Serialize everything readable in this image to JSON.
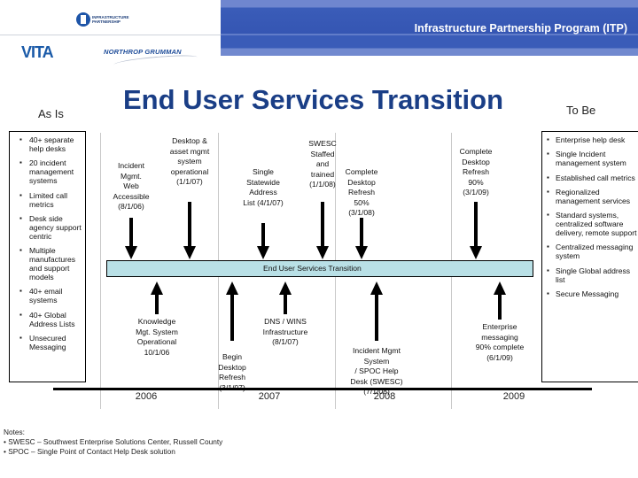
{
  "header": {
    "banner_title": "Infrastructure Partnership Program (ITP)",
    "logos": {
      "itp": "INFRASTRUCTURE PARTNERSHIP",
      "vita": "VITA",
      "northrop": "NORTHROP GRUMMAN"
    }
  },
  "title": "End User Services Transition",
  "as_is": {
    "label": "As Is",
    "items": [
      "40+ separate help desks",
      "20 incident management systems",
      "Limited call metrics",
      "Desk side agency support centric",
      "Multiple manufactures and support models",
      "40+ email systems",
      "40+ Global Address Lists",
      "Unsecured Messaging"
    ]
  },
  "to_be": {
    "label": "To Be",
    "items": [
      "Enterprise help desk",
      "Single Incident management system",
      "Established call metrics",
      "Regionalized management services",
      "Standard systems, centralized software delivery, remote support",
      "Centralized messaging system",
      "Single Global address list",
      "Secure Messaging"
    ]
  },
  "timeline": {
    "band_label": "End User Services Transition",
    "years": [
      "2006",
      "2007",
      "2008",
      "2009"
    ],
    "milestones_above": [
      {
        "lines": [
          "Incident",
          "Mgmt.",
          "Web",
          "Accessible",
          "(8/1/06)"
        ],
        "date": "8/1/06"
      },
      {
        "lines": [
          "Desktop &",
          "asset mgmt",
          "system",
          "operational",
          "(1/1/07)"
        ],
        "date": "1/1/07"
      },
      {
        "lines": [
          "Single",
          "Statewide",
          "Address",
          "List (4/1/07)"
        ],
        "date": "4/1/07"
      },
      {
        "lines": [
          "SWESC",
          "Staffed",
          "and",
          "trained",
          "(1/1/08)"
        ],
        "date": "1/1/08"
      },
      {
        "lines": [
          "Complete",
          "Desktop",
          "Refresh",
          "50%",
          "(3/1/08)"
        ],
        "date": "3/1/08"
      },
      {
        "lines": [
          "Complete",
          "Desktop",
          "Refresh",
          "90%",
          "(3/1/09)"
        ],
        "date": "3/1/09"
      }
    ],
    "milestones_below": [
      {
        "lines": [
          "Knowledge",
          "Mgt. System",
          "Operational",
          "10/1/06"
        ],
        "date": "10/1/06"
      },
      {
        "lines": [
          "Begin",
          "Desktop",
          "Refresh",
          "(3/1/07)"
        ],
        "date": "3/1/07"
      },
      {
        "lines": [
          "DNS / WINS",
          "Infrastructure",
          "(8/1/07)"
        ],
        "date": "8/1/07"
      },
      {
        "lines": [
          "Incident Mgmt",
          "System",
          "/ SPOC Help",
          "Desk (SWESC)",
          "(7/1/08)"
        ],
        "date": "7/1/08"
      },
      {
        "lines": [
          "Enterprise",
          "messaging",
          "90% complete",
          "(6/1/09)"
        ],
        "date": "6/1/09"
      }
    ]
  },
  "notes": {
    "heading": "Notes:",
    "items": [
      "SWESC – Southwest Enterprise Solutions Center, Russell County",
      "SPOC – Single Point of Contact Help Desk solution"
    ]
  },
  "colors": {
    "banner": "#3556b3",
    "title": "#1a3e86",
    "band": "#b9e0e6"
  }
}
